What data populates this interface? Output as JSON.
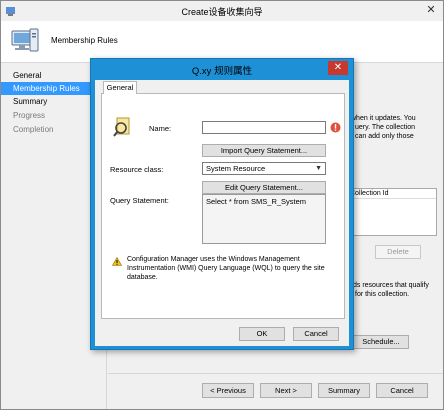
{
  "wizard": {
    "title": "Create设备收集向导",
    "header_title": "Membership Rules",
    "nav": [
      {
        "label": "General",
        "state": "normal"
      },
      {
        "label": "Membership Rules",
        "state": "active"
      },
      {
        "label": "Summary",
        "state": "normal"
      },
      {
        "label": "Progress",
        "state": "disabled"
      },
      {
        "label": "Completion",
        "state": "disabled"
      }
    ],
    "background_text": {
      "line1": "when it updates. You",
      "line2": "uery. The collection",
      "line3": "can add only those",
      "list_header": "Collection Id",
      "delete_label": "Delete",
      "qualify1": "ds resources that qualify",
      "qualify2": "for this collection.",
      "schedule_label": "Schedule..."
    },
    "footer": {
      "previous": "< Previous",
      "next": "Next >",
      "summary": "Summary",
      "cancel": "Cancel"
    }
  },
  "dialog": {
    "title": "Q.xy 规则属性",
    "close_glyph": "✕",
    "tab_general": "General",
    "name_label": "Name:",
    "name_value": "",
    "import_button": "Import Query Statement...",
    "resource_class_label": "Resource class:",
    "resource_class_value": "System Resource",
    "edit_button": "Edit Query Statement...",
    "query_label": "Query Statement:",
    "query_value": "Select * from SMS_R_System",
    "note": "Configuration Manager uses the Windows Management Instrumentation (WMI) Query Language (WQL) to query the site database.",
    "ok": "OK",
    "cancel": "Cancel"
  },
  "colors": {
    "dialog_frame": "#1e90d6",
    "nav_active": "#3399ff",
    "close_button": "#c7382f",
    "error_badge": "#e0503a",
    "warning_icon": "#f0c419"
  },
  "icons": [
    "computer-icon",
    "query-icon",
    "error-icon",
    "warning-icon",
    "close-icon",
    "chevron-down-icon"
  ]
}
